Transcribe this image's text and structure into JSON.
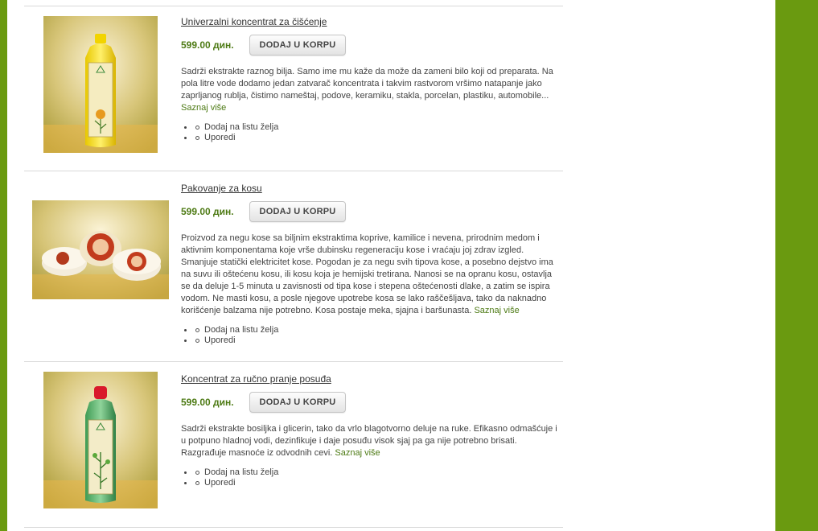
{
  "colors": {
    "accent": "#6a9a10",
    "price": "#4d7a14",
    "link_more": "#4d7a14"
  },
  "products": [
    {
      "title": "Univerzalni koncentrat za čišćenje",
      "price": "599.00 дин.",
      "button": "DODAJ U KORPU",
      "description": "Sadrži ekstrakte raznog bilja. Samo ime mu kaže da može da zameni bilo koji od preparata. Na pola litre vode dodamo jedan zatvarač koncentrata i takvim rastvorom vršimo natapanje jako zaprljanog rublja, čistimo nameštaj, podove, keramiku, stakla, porcelan, plastiku, automobile...",
      "more": "Saznaj više",
      "wishlist": "Dodaj na listu želja",
      "compare": "Uporedi",
      "image": "yellow-bottle-image"
    },
    {
      "title": "Pakovanje za kosu",
      "price": "599.00 дин.",
      "button": "DODAJ U KORPU",
      "description": "Proizvod za negu kose sa biljnim ekstraktima koprive, kamilice i nevena, prirodnim medom i aktivnim komponentama koje vrše dubinsku regeneraciju kose i vraćaju joj zdrav izgled. Smanjuje statički elektricitet kose. Pogodan je za negu svih tipova kose, a posebno dejstvo ima na suvu ili oštećenu kosu, ili kosu koja je hemijski tretirana. Nanosi se na opranu kosu, ostavlja se da deluje 1-5 minuta u zavisnosti od tipa kose i stepena oštećenosti dlake, a zatim se ispira vodom. Ne masti kosu, a posle njegove upotrebe kosa se lako raščešljava, tako da naknadno korišćenje balzama nije potrebno. Kosa postaje meka, sjajna i baršunasta.",
      "more": "Saznaj više",
      "wishlist": "Dodaj na listu želja",
      "compare": "Uporedi",
      "image": "hair-jars-image"
    },
    {
      "title": "Koncentrat za ručno pranje posuđa",
      "price": "599.00 дин.",
      "button": "DODAJ U KORPU",
      "description": "Sadrži ekstrakte bosiljka i glicerin, tako da vrlo blagotvorno deluje na ruke. Efikasno odmašćuje i u potpuno hladnoj vodi, dezinfikuje i daje posuđu visok sjaj pa ga nije potrebno brisati. Razgrađuje masnoće iz odvodnih cevi.",
      "more": "Saznaj više",
      "wishlist": "Dodaj na listu želja",
      "compare": "Uporedi",
      "image": "green-bottle-image"
    }
  ]
}
